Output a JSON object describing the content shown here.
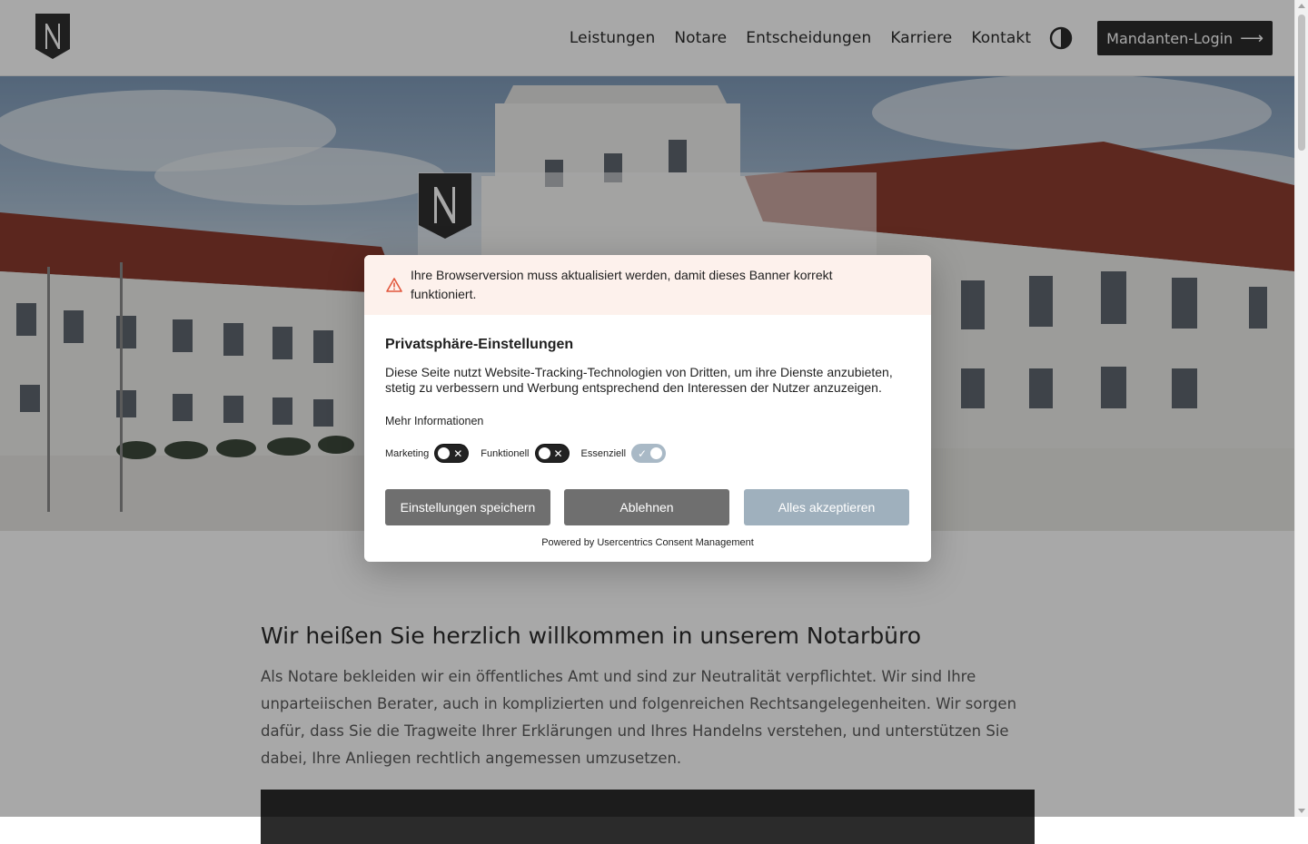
{
  "header": {
    "nav": [
      "Leistungen",
      "Notare",
      "Entscheidungen",
      "Karriere",
      "Kontakt"
    ],
    "login_label": "Mandanten-Login",
    "login_arrow": "⟶"
  },
  "main": {
    "welcome_title": "Wir heißen Sie herzlich willkommen in unserem Notarbüro",
    "intro_text": "Als Notare bekleiden wir ein öffentliches Amt und sind zur Neutralität verpflichtet. Wir sind Ihre unparteiischen Berater, auch in komplizierten und folgenreichen Rechtsangelegenheiten. Wir sorgen dafür, dass Sie die Tragweite Ihrer Erklärungen und Ihres Handelns verstehen, und unterstützen Sie dabei, Ihre Anliegen rechtlich angemessen umzusetzen."
  },
  "consent": {
    "warning": "Ihre Browserversion muss aktualisiert werden, damit dieses Banner korrekt funktioniert.",
    "title": "Privatsphäre-Einstellungen",
    "description": "Diese Seite nutzt Website-Tracking-Technologien von Dritten, um ihre Dienste anzubieten, stetig zu verbessern und Werbung entsprechend den Interessen der Nutzer anzuzeigen.",
    "more_info": "Mehr Informationen",
    "toggles": [
      {
        "label": "Marketing",
        "state": "off"
      },
      {
        "label": "Funktionell",
        "state": "off"
      },
      {
        "label": "Essenziell",
        "state": "on"
      }
    ],
    "buttons": {
      "save": "Einstellungen speichern",
      "decline": "Ablehnen",
      "accept": "Alles akzeptieren"
    },
    "powered_by": "Powered by Usercentrics Consent Management"
  },
  "colors": {
    "header_dark": "#2b2b2b",
    "warning_bg": "#fdf1ec",
    "warning_icon": "#e2573d",
    "button_gray": "#6f6f6f",
    "button_accept": "#9fb0bd"
  }
}
